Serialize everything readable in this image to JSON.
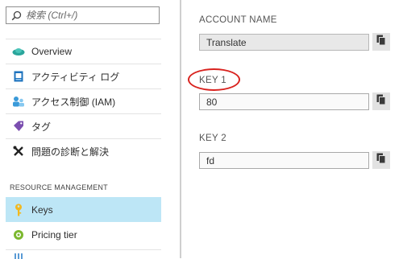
{
  "search": {
    "placeholder": "検索 (Ctrl+/)"
  },
  "sidebar": {
    "items": [
      {
        "label": "Overview",
        "icon": "overview-icon"
      },
      {
        "label": "アクティビティ ログ",
        "icon": "activity-log-icon"
      },
      {
        "label": "アクセス制御 (IAM)",
        "icon": "iam-icon"
      },
      {
        "label": "タグ",
        "icon": "tag-icon"
      },
      {
        "label": "問題の診断と解決",
        "icon": "tools-icon"
      }
    ],
    "section_label": "RESOURCE MANAGEMENT",
    "resource_items": [
      {
        "label": "Keys",
        "icon": "key-icon",
        "active": true
      },
      {
        "label": "Pricing tier",
        "icon": "pricing-tier-icon",
        "active": false
      }
    ]
  },
  "main": {
    "account_name": {
      "label": "ACCOUNT NAME",
      "value": "Translate"
    },
    "key1": {
      "label": "KEY 1",
      "value": "80"
    },
    "key2": {
      "label": "KEY 2",
      "value": "fd"
    }
  },
  "colors": {
    "active_bg": "#bde6f6",
    "annotation": "#d9231f"
  }
}
